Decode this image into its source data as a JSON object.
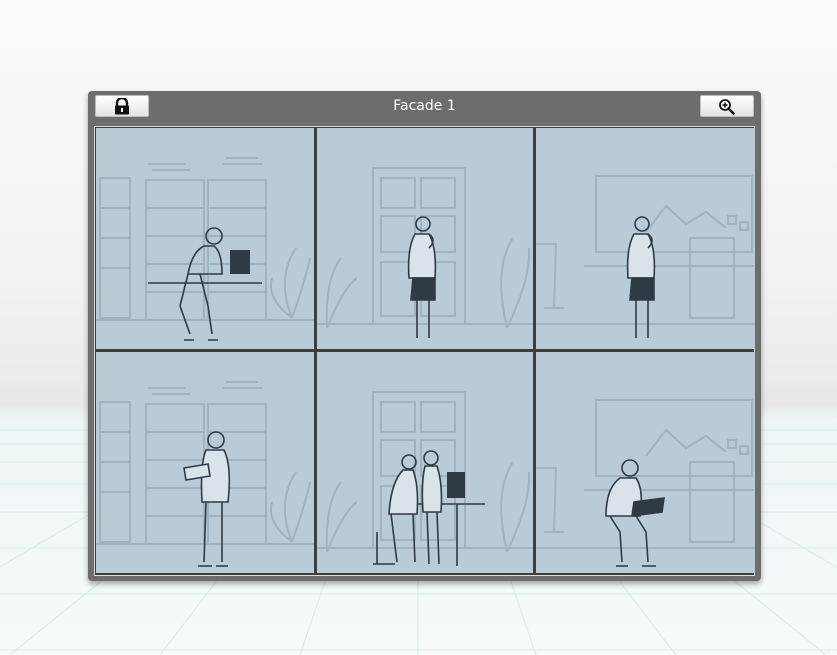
{
  "window": {
    "title": "Facade 1",
    "lock_icon": "lock-icon",
    "zoom_icon": "zoom-in-icon"
  },
  "cells": [
    {
      "scene": "man-at-desk-with-laptop",
      "background": "file-cabinets"
    },
    {
      "scene": "woman-on-phone",
      "background": "door"
    },
    {
      "scene": "woman-on-phone",
      "background": "whiteboard"
    },
    {
      "scene": "man-reading-document",
      "background": "file-cabinets"
    },
    {
      "scene": "two-women-at-computer",
      "background": "door"
    },
    {
      "scene": "man-sitting-with-laptop",
      "background": "whiteboard"
    }
  ],
  "colors": {
    "panel": "#6d6d6d",
    "cell_bg": "#b8cbd6",
    "line_art": "#2f3b44",
    "muted": "#9fb4c1"
  }
}
